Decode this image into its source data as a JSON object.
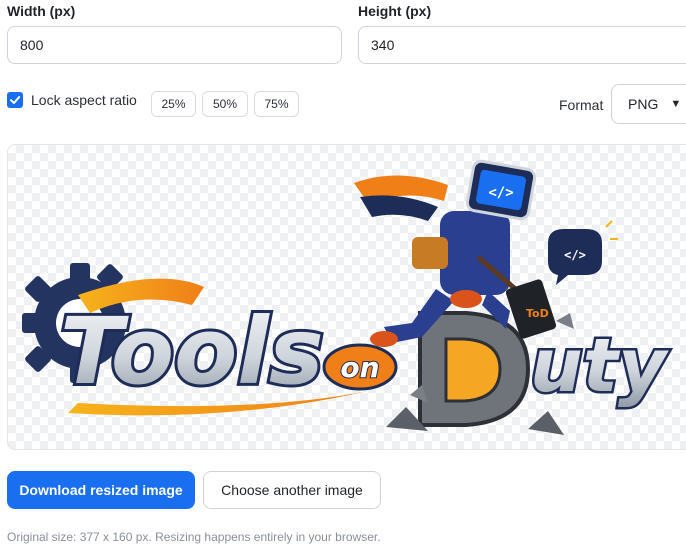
{
  "width": {
    "label": "Width (px)",
    "value": "800"
  },
  "height": {
    "label": "Height (px)",
    "value": "340"
  },
  "lock": {
    "label": "Lock aspect ratio",
    "checked": true
  },
  "presets": [
    "25%",
    "50%",
    "75%"
  ],
  "format": {
    "label": "Format",
    "selected": "PNG"
  },
  "preview": {
    "logo_text_part1": "Tools",
    "logo_text_part2": "on",
    "logo_text_part3": "uty",
    "logo_badge": "ToD",
    "code_glyph": "</>"
  },
  "actions": {
    "download": "Download resized image",
    "choose": "Choose another image"
  },
  "footnote": "Original size: 377 x 160 px. Resizing happens entirely in your browser.",
  "colors": {
    "accent": "#1a6ff0",
    "logo_orange": "#f07f18",
    "logo_navy": "#1e2c58"
  }
}
